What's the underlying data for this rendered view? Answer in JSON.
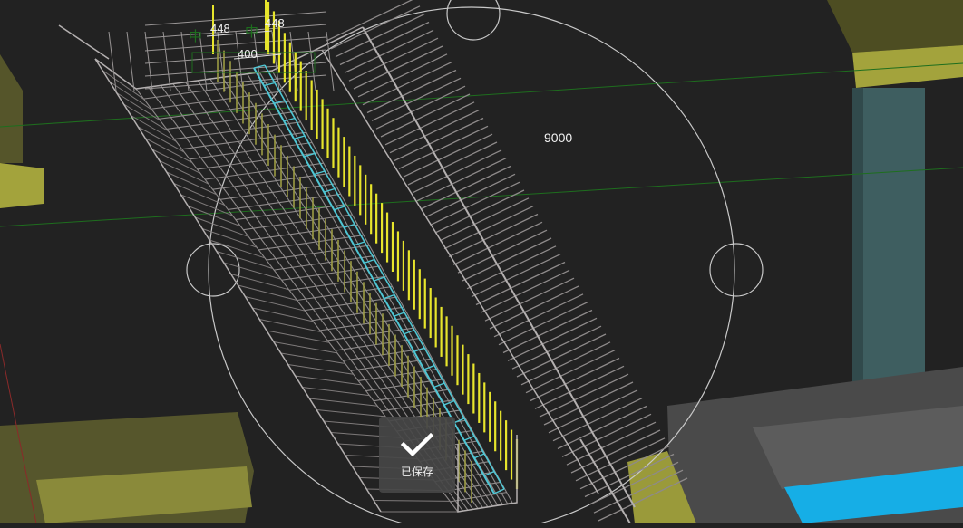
{
  "viewport": {
    "dimension_radius": "9000",
    "dimension_a": "448",
    "dimension_b": "448",
    "dimension_c": "400",
    "colors": {
      "background": "#222222",
      "rebar_yellow": "#e7e52c",
      "stirrup_cyan": "#4fc6d4",
      "mesh_grey": "#b4b0b0",
      "beam_olive": "#8f8f38",
      "column_teal": "#3e5e60",
      "slab_blue": "#16aee6",
      "guide_green": "#1e6e1e"
    },
    "icons": [
      "rotation-gizmo-circle",
      "gizmo-handle-icon"
    ]
  },
  "toast": {
    "icon": "check-icon",
    "message": "已保存"
  }
}
